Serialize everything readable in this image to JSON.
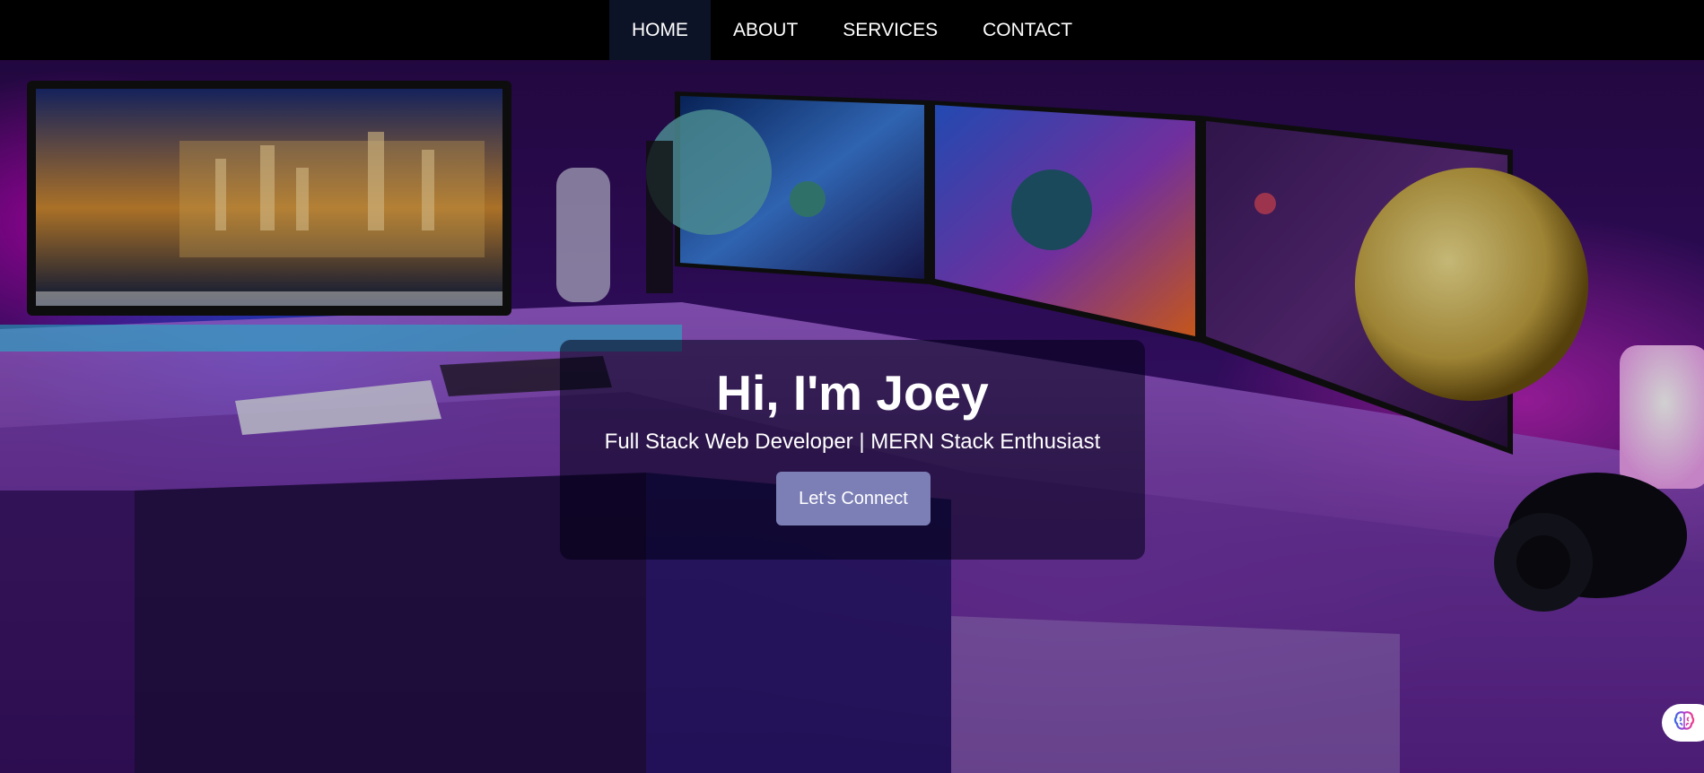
{
  "nav": {
    "items": [
      {
        "label": "HOME",
        "active": true
      },
      {
        "label": "ABOUT",
        "active": false
      },
      {
        "label": "SERVICES",
        "active": false
      },
      {
        "label": "CONTACT",
        "active": false
      }
    ]
  },
  "hero": {
    "title": "Hi, I'm Joey",
    "subtitle": "Full Stack Web Developer | MERN Stack Enthusiast",
    "cta_label": "Let's Connect",
    "background_image": "neon-lit-desk-setup-with-four-monitors"
  },
  "assistant": {
    "icon": "brain-icon"
  },
  "colors": {
    "nav_bg": "#000000",
    "nav_active_bg": "#0d1326",
    "cta_bg": "#7c7fb6",
    "text": "#ffffff"
  }
}
